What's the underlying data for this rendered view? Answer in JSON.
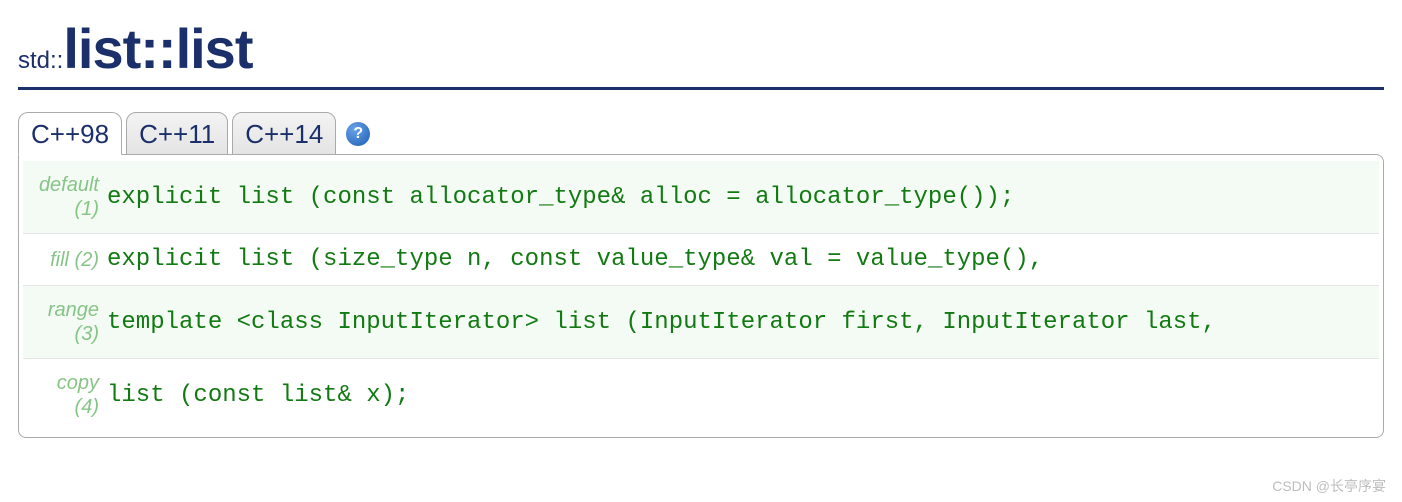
{
  "title": {
    "prefix": "std::",
    "main": "list::list"
  },
  "tabs": [
    {
      "label": "C++98",
      "active": true
    },
    {
      "label": "C++11",
      "active": false
    },
    {
      "label": "C++14",
      "active": false
    }
  ],
  "help_glyph": "?",
  "signatures": [
    {
      "name": "default",
      "num": "(1)",
      "code": "explicit list (const allocator_type& alloc = allocator_type());"
    },
    {
      "name": "fill",
      "num": "(2)",
      "code": "explicit list (size_type n, const value_type& val = value_type(),"
    },
    {
      "name": "range",
      "num": "(3)",
      "code": "template <class InputIterator>  list (InputIterator first, InputIterator last,"
    },
    {
      "name": "copy",
      "num": "(4)",
      "code": "list (const list& x);"
    }
  ],
  "watermark": "CSDN @长亭序宴"
}
